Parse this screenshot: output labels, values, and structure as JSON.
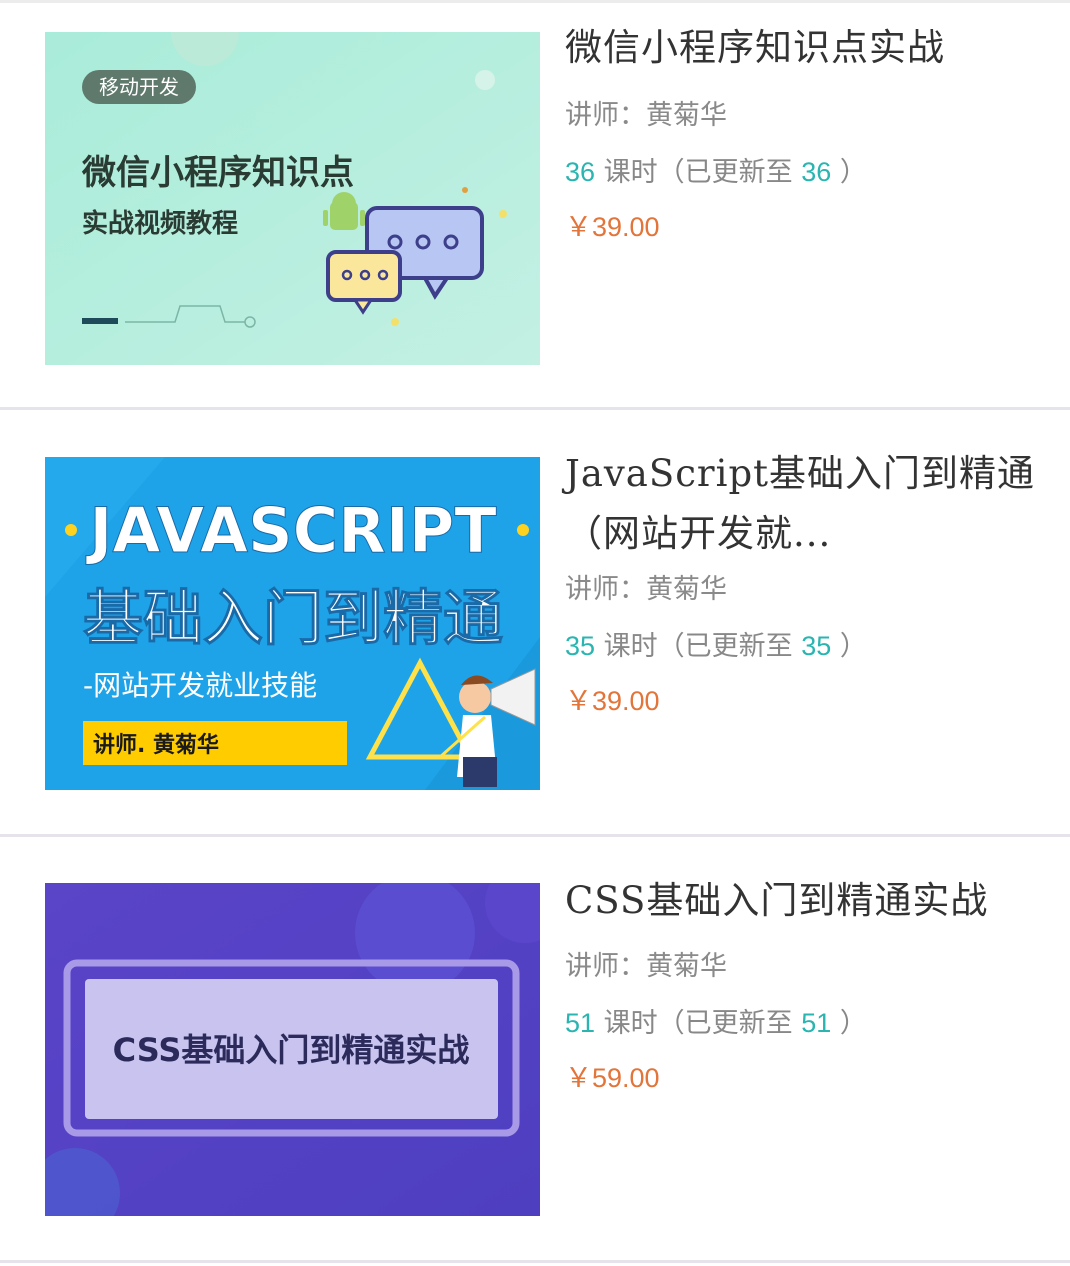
{
  "courses": [
    {
      "title": "微信小程序知识点实战",
      "teacher": "讲师：黄菊华",
      "lesson_count": "36",
      "lesson_word": "课时（已更新至",
      "updated_to": "36",
      "close_paren": "）",
      "price": "￥39.00",
      "thumb": {
        "badge": "移动开发",
        "line1": "微信小程序知识点",
        "line2": "实战视频教程"
      }
    },
    {
      "title": "JavaScript基础入门到精通（网站开发就...",
      "teacher": "讲师：黄菊华",
      "lesson_count": "35",
      "lesson_word": "课时（已更新至",
      "updated_to": "35",
      "close_paren": "）",
      "price": "￥39.00",
      "thumb": {
        "line1": "JAVASCRIPT",
        "line2": "基础入门到精通",
        "line3": "-网站开发就业技能",
        "line4": "讲师. 黄菊华"
      }
    },
    {
      "title": "CSS基础入门到精通实战",
      "teacher": "讲师：黄菊华",
      "lesson_count": "51",
      "lesson_word": "课时（已更新至",
      "updated_to": "51",
      "close_paren": "）",
      "price": "￥59.00",
      "thumb": {
        "line1": "CSS基础入门到精通实战"
      }
    }
  ],
  "colors": {
    "teal_count": "#2bb5b0",
    "price_orange": "#e3743a",
    "title_text": "#333333",
    "divider": "#e6e4ea"
  },
  "icons": [
    "android-icon",
    "chat-bubble-icon",
    "megaphone-person-illustration"
  ]
}
